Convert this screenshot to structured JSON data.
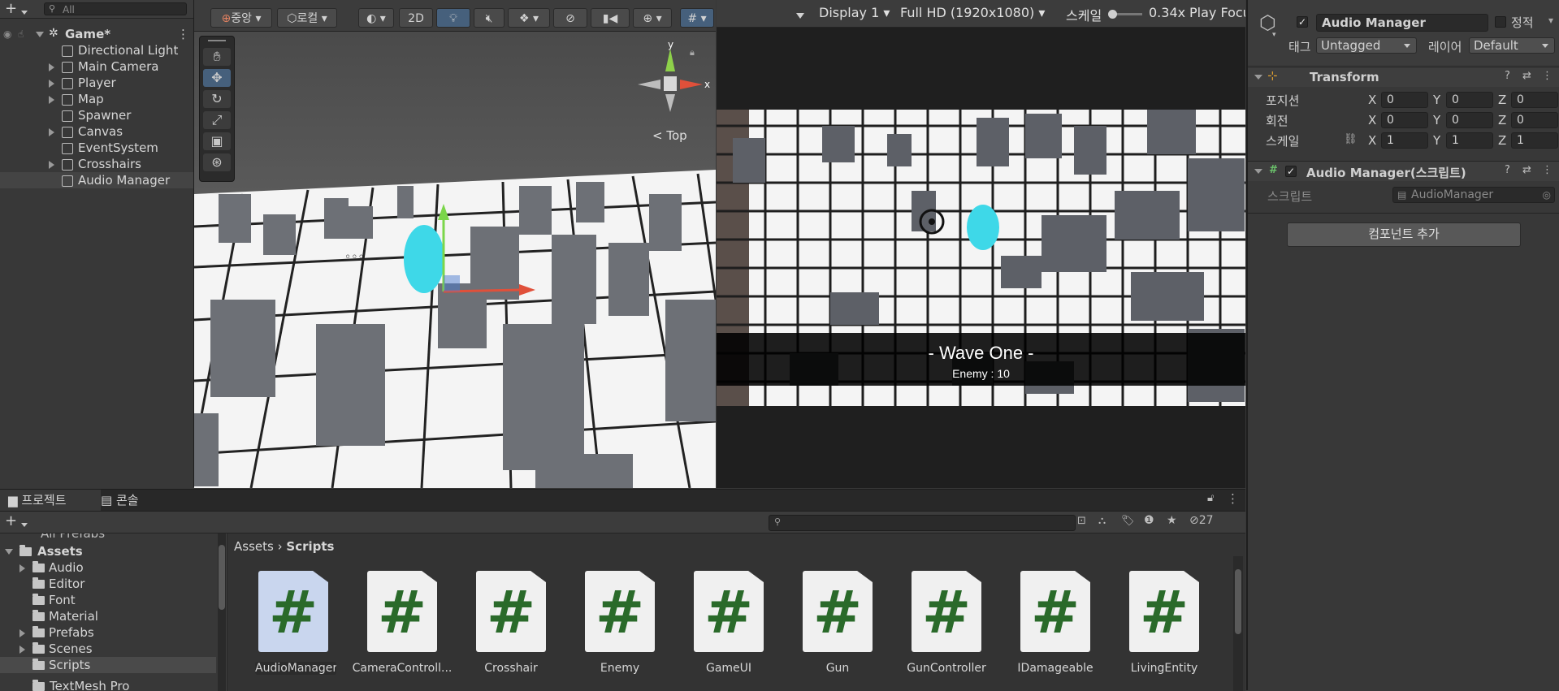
{
  "hierarchy": {
    "search_placeholder": "All",
    "scene_name": "Game*",
    "items": [
      {
        "label": "Directional Light",
        "expandable": false
      },
      {
        "label": "Main Camera",
        "expandable": true
      },
      {
        "label": "Player",
        "expandable": true
      },
      {
        "label": "Map",
        "expandable": true
      },
      {
        "label": "Spawner",
        "expandable": false
      },
      {
        "label": "Canvas",
        "expandable": true
      },
      {
        "label": "EventSystem",
        "expandable": false
      },
      {
        "label": "Crosshairs",
        "expandable": true
      },
      {
        "label": "Audio Manager",
        "expandable": false
      }
    ]
  },
  "scene": {
    "pivot_label": "중앙",
    "space_label": "로컬",
    "mode_2d": "2D",
    "gizmo_view_label": "Top",
    "axis_y": "y",
    "axis_x": "x"
  },
  "game": {
    "display": "Display 1",
    "resolution": "Full HD (1920x1080)",
    "scale_label": "스케일",
    "scale_value": "0.34x",
    "play_focus": "Play Focu",
    "wave_title": "- Wave One -",
    "enemy_count": "Enemy : 10"
  },
  "inspector": {
    "object_name": "Audio Manager",
    "static_label": "정적",
    "tag_label": "태그",
    "tag_value": "Untagged",
    "layer_label": "레이어",
    "layer_value": "Default",
    "transform_title": "Transform",
    "position_label": "포지션",
    "rotation_label": "회전",
    "scale_label": "스케일",
    "position": {
      "x": "0",
      "y": "0",
      "z": "0"
    },
    "rotation": {
      "x": "0",
      "y": "0",
      "z": "0"
    },
    "scale": {
      "x": "1",
      "y": "1",
      "z": "1"
    },
    "axis_x": "X",
    "axis_y": "Y",
    "axis_z": "Z",
    "script_component_title": "Audio Manager(스크립트)",
    "script_label": "스크립트",
    "script_value": "AudioManager",
    "add_component": "컴포넌트 추가"
  },
  "project": {
    "tab_project": "프로젝트",
    "tab_console": "콘솔",
    "hidden_count": "27",
    "breadcrumb_root": "Assets",
    "breadcrumb_current": "Scripts",
    "tree_cut_top": "All Prefabs",
    "tree_root": "Assets",
    "tree_items": [
      {
        "label": "Audio",
        "expandable": true
      },
      {
        "label": "Editor",
        "expandable": false
      },
      {
        "label": "Font",
        "expandable": false
      },
      {
        "label": "Material",
        "expandable": false
      },
      {
        "label": "Prefabs",
        "expandable": true
      },
      {
        "label": "Scenes",
        "expandable": true
      },
      {
        "label": "Scripts",
        "expandable": false
      }
    ],
    "tree_cut_bottom": "TextMesh Pro",
    "assets": [
      {
        "label": "AudioManager",
        "selected": true
      },
      {
        "label": "CameraControll...",
        "selected": false
      },
      {
        "label": "Crosshair",
        "selected": false
      },
      {
        "label": "Enemy",
        "selected": false
      },
      {
        "label": "GameUI",
        "selected": false
      },
      {
        "label": "Gun",
        "selected": false
      },
      {
        "label": "GunController",
        "selected": false
      },
      {
        "label": "IDamageable",
        "selected": false
      },
      {
        "label": "LivingEntity",
        "selected": false
      }
    ],
    "asset_glyph": "#"
  },
  "colors": {
    "editor_bg": "#383838",
    "selection_blue": "#46607c",
    "script_green": "#2a6a2a"
  }
}
